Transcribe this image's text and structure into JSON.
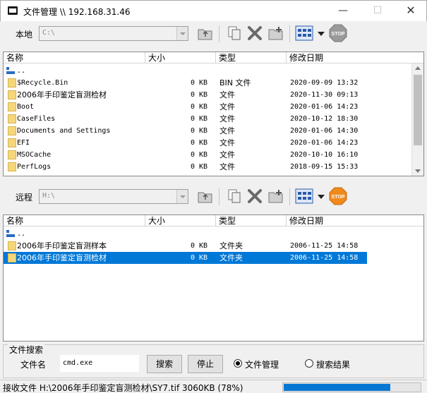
{
  "window": {
    "title": "文件管理 \\\\ 192.168.31.46",
    "min_glyph": "—",
    "max_glyph": "☐",
    "close_glyph": "✕"
  },
  "local": {
    "label": "本地",
    "path": "C:\\",
    "columns": [
      "名称",
      "大小",
      "类型",
      "修改日期"
    ],
    "up_label": "..",
    "rows": [
      {
        "name": "$Recycle.Bin",
        "size": "0 KB",
        "type": "BIN 文件",
        "date": "2020-09-09 13:32"
      },
      {
        "name": "2006年手印鉴定盲测检材",
        "size": "0 KB",
        "type": "文件",
        "date": "2020-11-30 09:13"
      },
      {
        "name": "Boot",
        "size": "0 KB",
        "type": "文件",
        "date": "2020-01-06 14:23"
      },
      {
        "name": "CaseFiles",
        "size": "0 KB",
        "type": "文件",
        "date": "2020-10-12 18:30"
      },
      {
        "name": "Documents and Settings",
        "size": "0 KB",
        "type": "文件",
        "date": "2020-01-06 14:30"
      },
      {
        "name": "EFI",
        "size": "0 KB",
        "type": "文件",
        "date": "2020-01-06 14:23"
      },
      {
        "name": "MSOCache",
        "size": "0 KB",
        "type": "文件",
        "date": "2020-10-10 16:10"
      },
      {
        "name": "PerfLogs",
        "size": "0 KB",
        "type": "文件",
        "date": "2018-09-15 15:33"
      }
    ]
  },
  "remote": {
    "label": "远程",
    "path": "H:\\",
    "columns": [
      "名称",
      "大小",
      "类型",
      "修改日期"
    ],
    "up_label": "..",
    "rows": [
      {
        "name": "2006年手印鉴定盲测样本",
        "size": "0 KB",
        "type": "文件夹",
        "date": "2006-11-25 14:58"
      },
      {
        "name": "2006年手印鉴定盲测检材",
        "size": "0 KB",
        "type": "文件夹",
        "date": "2006-11-25 14:58"
      }
    ]
  },
  "toolbar": {
    "stop_label": "STOP"
  },
  "search": {
    "group_label": "文件搜索",
    "file_label": "文件名",
    "file_value": "cmd.exe",
    "search_button": "搜索",
    "stop_button": "停止",
    "radio_file_manage": "文件管理",
    "radio_search_results": "搜索结果",
    "selected": "文件管理"
  },
  "status": {
    "text": "接收文件 H:\\2006年手印鉴定盲测检材\\SY7.tif 3060KB (78%)",
    "progress": 0.78
  },
  "colors": {
    "selection": "#0078d7",
    "progress": "#0678d4",
    "stop_local": "#9a9a9a",
    "stop_remote": "#f08a1c"
  }
}
